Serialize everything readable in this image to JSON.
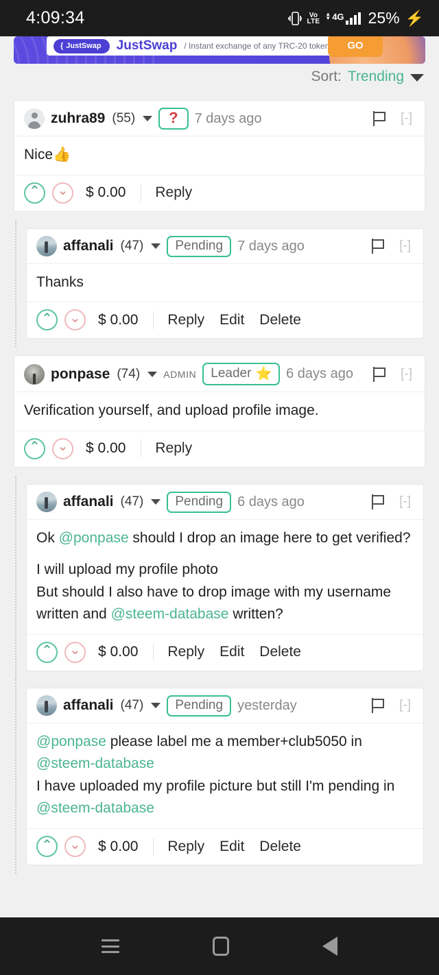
{
  "status_bar": {
    "time": "4:09:34",
    "vibrate_icon": "vibrate-icon",
    "volte_top": "Vo",
    "volte_bottom": "LTE",
    "network": "4G",
    "battery_percent": "25%",
    "charging_icon": "bolt-icon"
  },
  "ad_banner": {
    "pill_label": "JustSwap",
    "brand": "JustSwap",
    "tagline": "/ Instant exchange of any TRC-20 token",
    "cta": "GO"
  },
  "sort": {
    "label": "Sort:",
    "value": "Trending"
  },
  "colors": {
    "accent_green": "#4ab58e",
    "badge_border": "#37c08f",
    "question_red": "#d63b3b",
    "downvote_red": "#de8a90",
    "page_bg": "#f0f0f0",
    "banner_purple": "#5547dd",
    "cta_orange": "#f59c32"
  },
  "comments": [
    {
      "id": "c1",
      "nested": false,
      "avatar": "default",
      "username": "zuhra89",
      "reputation": "(55)",
      "admin_tag": "",
      "badge": "?",
      "badge_star": "",
      "time": "7 days ago",
      "collapse": "[-]",
      "body_lines": [
        [
          {
            "t": "Nice👍",
            "mention": false
          }
        ]
      ],
      "payout": "$ 0.00",
      "actions": [
        "Reply"
      ]
    },
    {
      "id": "c2",
      "nested": true,
      "avatar": "photo-affanali",
      "username": "affanali",
      "reputation": "(47)",
      "admin_tag": "",
      "badge": "Pending",
      "badge_star": "",
      "time": "7 days ago",
      "collapse": "[-]",
      "body_lines": [
        [
          {
            "t": "Thanks",
            "mention": false
          }
        ]
      ],
      "payout": "$ 0.00",
      "actions": [
        "Reply",
        "Edit",
        "Delete"
      ]
    },
    {
      "id": "c3",
      "nested": false,
      "avatar": "photo-ponpase",
      "username": "ponpase",
      "reputation": "(74)",
      "admin_tag": "ADMIN",
      "badge": "Leader",
      "badge_star": "⭐",
      "time": "6 days ago",
      "collapse": "[-]",
      "body_lines": [
        [
          {
            "t": "Verification yourself, and upload profile image.",
            "mention": false
          }
        ]
      ],
      "payout": "$ 0.00",
      "actions": [
        "Reply"
      ]
    },
    {
      "id": "c4",
      "nested": true,
      "avatar": "photo-affanali",
      "username": "affanali",
      "reputation": "(47)",
      "admin_tag": "",
      "badge": "Pending",
      "badge_star": "",
      "time": "6 days ago",
      "collapse": "[-]",
      "body_lines": [
        [
          {
            "t": "Ok ",
            "mention": false
          },
          {
            "t": "@ponpase",
            "mention": true
          },
          {
            "t": " should I drop an image here to get verified?",
            "mention": false
          }
        ],
        [
          {
            "t": "I will upload my profile photo",
            "mention": false
          }
        ],
        [
          {
            "t": "But should I also have to drop image with my username written and ",
            "mention": false
          },
          {
            "t": "@steem-database",
            "mention": true
          },
          {
            "t": " written?",
            "mention": false
          }
        ]
      ],
      "payout": "$ 0.00",
      "actions": [
        "Reply",
        "Edit",
        "Delete"
      ]
    },
    {
      "id": "c5",
      "nested": true,
      "avatar": "photo-affanali",
      "username": "affanali",
      "reputation": "(47)",
      "admin_tag": "",
      "badge": "Pending",
      "badge_star": "",
      "time": "yesterday",
      "collapse": "[-]",
      "body_lines": [
        [
          {
            "t": "@ponpase",
            "mention": true
          },
          {
            "t": " please label me a member+club5050 in ",
            "mention": false
          },
          {
            "t": "@steem-database",
            "mention": true
          }
        ],
        [
          {
            "t": "I have uploaded my profile picture but still I'm pending in ",
            "mention": false
          },
          {
            "t": "@steem-database",
            "mention": true
          }
        ]
      ],
      "payout": "$ 0.00",
      "actions": [
        "Reply",
        "Edit",
        "Delete"
      ]
    }
  ],
  "nav_bar": {
    "recents": "recents-icon",
    "home": "home-icon",
    "back": "back-icon"
  }
}
